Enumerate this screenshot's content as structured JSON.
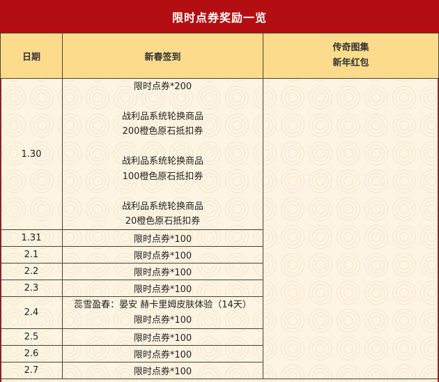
{
  "title": "限时点券奖励一览",
  "headers": {
    "date": "日期",
    "signin": "新春签到",
    "gift_line1": "传奇图集",
    "gift_line2": "新年红包"
  },
  "first_row": {
    "date": "1.30",
    "lines": [
      "限时点券*200",
      "",
      "战利品系统轮换商品",
      "200橙色原石抵扣券",
      "",
      "战利品系统轮换商品",
      "100橙色原石抵扣券",
      "",
      "战利品系统轮换商品",
      "20橙色原石抵扣券"
    ]
  },
  "rows": [
    {
      "date": "1.31",
      "reward": "限时点券*100"
    },
    {
      "date": "2.1",
      "reward": "限时点券*100"
    },
    {
      "date": "2.2",
      "reward": "限时点券*100"
    },
    {
      "date": "2.3",
      "reward": "限时点券*100"
    },
    {
      "date": "2.4",
      "reward_line1": "蕊雪盈春：晏安 赫卡里姆皮肤体验（14天）",
      "reward_line2": "限时点券*100"
    },
    {
      "date": "2.5",
      "reward": "限时点券*100"
    },
    {
      "date": "2.6",
      "reward": "限时点券*100"
    },
    {
      "date": "2.7",
      "reward": "限时点券*100"
    }
  ],
  "colors": {
    "title_bg": "#b30f12",
    "header_bg": "#fcdc8c",
    "highlight_text": "#b7282e",
    "page_bg": "#fdf4e2"
  }
}
